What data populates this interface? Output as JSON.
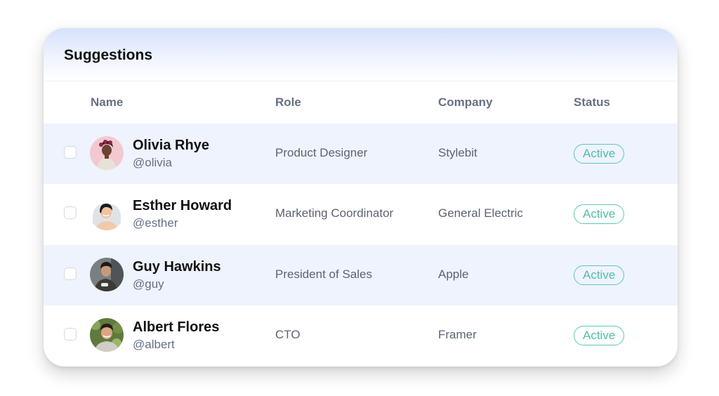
{
  "card": {
    "title": "Suggestions"
  },
  "table": {
    "columns": {
      "name": "Name",
      "role": "Role",
      "company": "Company",
      "status": "Status"
    },
    "rows": [
      {
        "name": "Olivia Rhye",
        "handle": "@olivia",
        "role": "Product Designer",
        "company": "Stylebit",
        "status": "Active",
        "selected": false,
        "avatar": "olivia-photo"
      },
      {
        "name": "Esther Howard",
        "handle": "@esther",
        "role": "Marketing Coordinator",
        "company": "General Electric",
        "status": "Active",
        "selected": false,
        "avatar": "esther-photo"
      },
      {
        "name": "Guy Hawkins",
        "handle": "@guy",
        "role": "President of Sales",
        "company": "Apple",
        "status": "Active",
        "selected": false,
        "avatar": "guy-photo"
      },
      {
        "name": "Albert Flores",
        "handle": "@albert",
        "role": "CTO",
        "company": "Framer",
        "status": "Active",
        "selected": false,
        "avatar": "albert-photo"
      }
    ]
  },
  "colors": {
    "status_active": "#4dbfa9",
    "row_highlight": "#eff3fe",
    "header_gradient": "#d6e2fc"
  }
}
